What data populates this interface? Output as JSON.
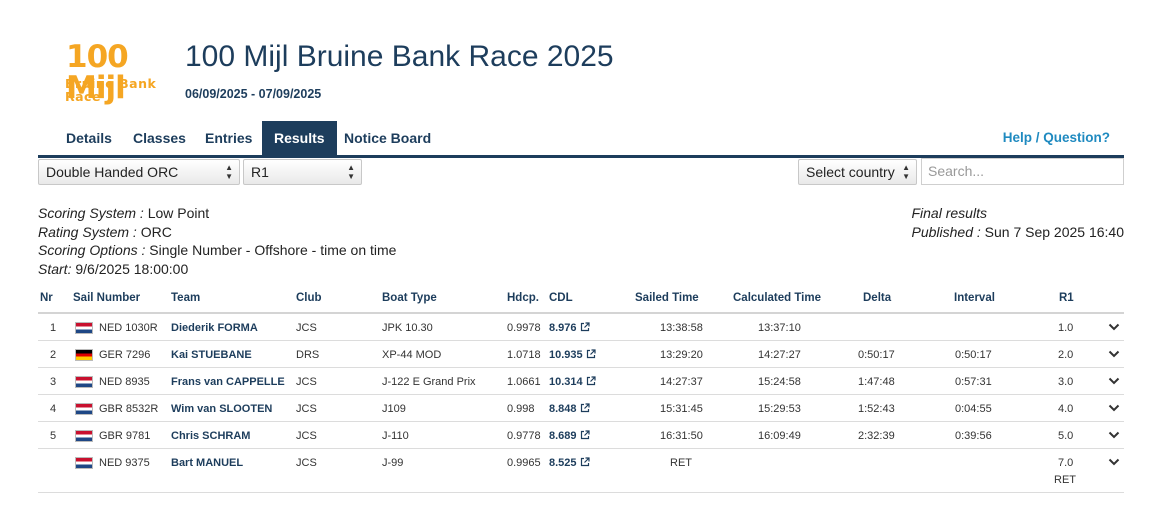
{
  "event": {
    "logo_text_big": "100 Mijl",
    "logo_text_small": "Bruine Bank Race",
    "title": "100 Mijl Bruine Bank Race 2025",
    "dates": "06/09/2025 - 07/09/2025"
  },
  "nav": {
    "tabs": [
      "Details",
      "Classes",
      "Entries",
      "Results",
      "Notice Board"
    ],
    "active_tab": "Results",
    "help": "Help / Question?"
  },
  "filters": {
    "class_select": "Double Handed ORC",
    "race_select": "R1",
    "country_select": "Select country",
    "search_placeholder": "Search..."
  },
  "meta": {
    "scoring_system_label": "Scoring System :",
    "scoring_system": "Low Point",
    "rating_system_label": "Rating System :",
    "rating_system": "ORC",
    "scoring_options_label": "Scoring Options :",
    "scoring_options": "Single Number - Offshore - time on time",
    "start_label": "Start:",
    "start": "9/6/2025 18:00:00",
    "status": "Final results",
    "published_label": "Published :",
    "published": "Sun 7 Sep 2025 16:40"
  },
  "table": {
    "headers": [
      "Nr",
      "Sail Number",
      "Team",
      "Club",
      "Boat Type",
      "Hdcp.",
      "CDL",
      "Sailed Time",
      "Calculated Time",
      "Delta",
      "Interval",
      "R1"
    ],
    "rows": [
      {
        "nr": "1",
        "flag": "ned",
        "sail": "NED 1030R",
        "team": "Diederik FORMA",
        "club": "JCS",
        "boat": "JPK 10.30",
        "hdcp": "0.9978",
        "cdl": "8.976",
        "sailed": "13:38:58",
        "calc": "13:37:10",
        "delta": "",
        "interval": "",
        "r1": "1.0",
        "r1_note": ""
      },
      {
        "nr": "2",
        "flag": "ger",
        "sail": "GER 7296",
        "team": "Kai STUEBANE",
        "club": "DRS",
        "boat": "XP-44 MOD",
        "hdcp": "1.0718",
        "cdl": "10.935",
        "sailed": "13:29:20",
        "calc": "14:27:27",
        "delta": "0:50:17",
        "interval": "0:50:17",
        "r1": "2.0",
        "r1_note": ""
      },
      {
        "nr": "3",
        "flag": "ned",
        "sail": "NED 8935",
        "team": "Frans van CAPPELLE",
        "club": "JCS",
        "boat": "J-122 E Grand Prix",
        "hdcp": "1.0661",
        "cdl": "10.314",
        "sailed": "14:27:37",
        "calc": "15:24:58",
        "delta": "1:47:48",
        "interval": "0:57:31",
        "r1": "3.0",
        "r1_note": ""
      },
      {
        "nr": "4",
        "flag": "ned",
        "sail": "GBR 8532R",
        "team": "Wim van SLOOTEN",
        "club": "JCS",
        "boat": "J109",
        "hdcp": "0.998",
        "cdl": "8.848",
        "sailed": "15:31:45",
        "calc": "15:29:53",
        "delta": "1:52:43",
        "interval": "0:04:55",
        "r1": "4.0",
        "r1_note": ""
      },
      {
        "nr": "5",
        "flag": "ned",
        "sail": "GBR 9781",
        "team": "Chris SCHRAM",
        "club": "JCS",
        "boat": "J-110",
        "hdcp": "0.9778",
        "cdl": "8.689",
        "sailed": "16:31:50",
        "calc": "16:09:49",
        "delta": "2:32:39",
        "interval": "0:39:56",
        "r1": "5.0",
        "r1_note": ""
      },
      {
        "nr": "",
        "flag": "ned",
        "sail": "NED 9375",
        "team": "Bart MANUEL",
        "club": "JCS",
        "boat": "J-99",
        "hdcp": "0.9965",
        "cdl": "8.525",
        "sailed": "RET",
        "calc": "",
        "delta": "",
        "interval": "",
        "r1": "7.0",
        "r1_note": "RET"
      }
    ]
  },
  "colors": {
    "navy": "#1d3d5c",
    "orange": "#f5a623",
    "link_blue": "#1f8ac0"
  }
}
